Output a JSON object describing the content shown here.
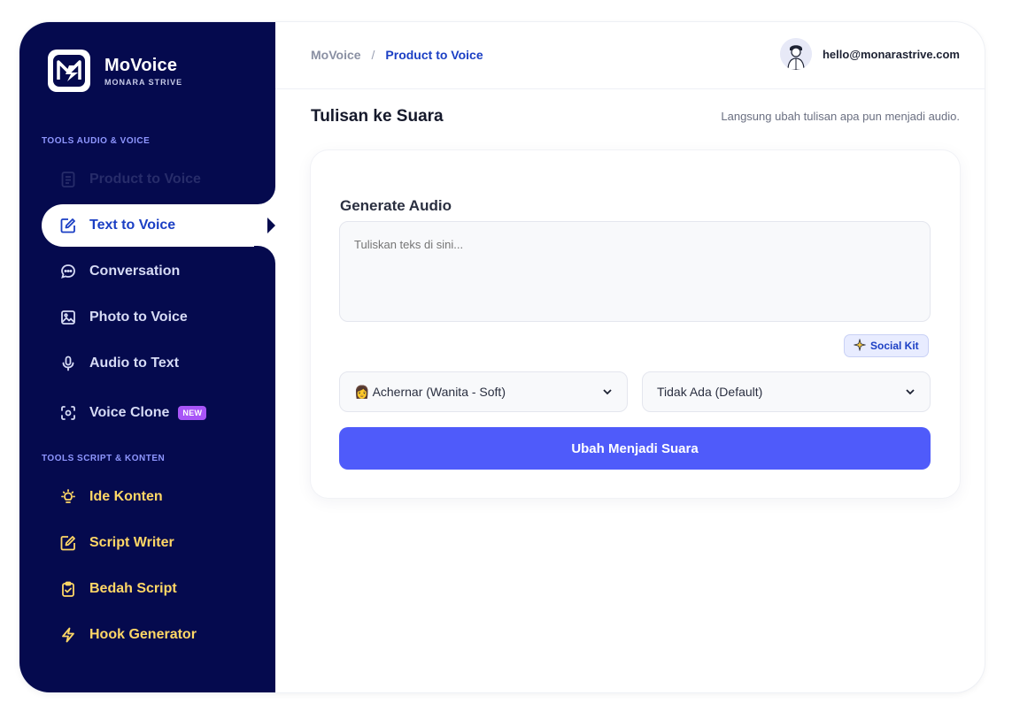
{
  "brand": {
    "name": "MoVoice",
    "subtitle": "MONARA STRIVE"
  },
  "sidebar": {
    "section_audio": "TOOLS AUDIO & VOICE",
    "section_script": "TOOLS SCRIPT & KONTEN",
    "items": [
      {
        "label": "Product to Voice",
        "icon": "document-icon",
        "state": "dim"
      },
      {
        "label": "Text to Voice",
        "icon": "edit-icon",
        "state": "active"
      },
      {
        "label": "Conversation",
        "icon": "chat-bubble-icon",
        "state": "normal"
      },
      {
        "label": "Photo to Voice",
        "icon": "image-icon",
        "state": "normal"
      },
      {
        "label": "Audio to Text",
        "icon": "microphone-icon",
        "state": "normal"
      },
      {
        "label": "Voice Clone",
        "icon": "voice-clone-icon",
        "state": "normal",
        "badge": "NEW"
      },
      {
        "label": "Ide Konten",
        "icon": "lightbulb-icon",
        "state": "yellow"
      },
      {
        "label": "Script Writer",
        "icon": "edit-icon",
        "state": "yellow"
      },
      {
        "label": "Bedah Script",
        "icon": "clipboard-check-icon",
        "state": "yellow"
      },
      {
        "label": "Hook Generator",
        "icon": "lightning-icon",
        "state": "yellow"
      }
    ]
  },
  "breadcrumb": {
    "root": "MoVoice",
    "separator": "/",
    "current": "Product to Voice"
  },
  "user": {
    "email": "hello@monarastrive.com"
  },
  "page": {
    "title": "Tulisan ke Suara",
    "description": "Langsung ubah tulisan apa pun menjadi audio."
  },
  "card": {
    "title": "Generate Audio",
    "textarea_placeholder": "Tuliskan teks di sini...",
    "social_kit_label": "Social Kit",
    "voice_select_value": "Achernar (Wanita - Soft)",
    "voice_select_emoji": "👩",
    "style_select_value": "Tidak Ada (Default)",
    "convert_button_label_a": "Ubah",
    "convert_button_label_b": " Menjadi Suara"
  },
  "colors": {
    "sidebar_bg": "#050a4e",
    "accent": "#4f5bfa",
    "active_text": "#1b3fc4",
    "script_tools_text": "#ffd766",
    "badge_new": "#a855f7"
  }
}
